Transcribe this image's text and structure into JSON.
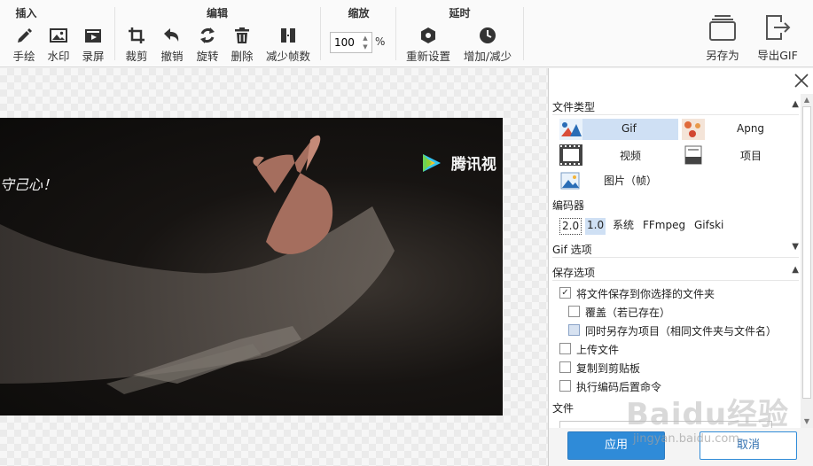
{
  "ribbon": {
    "groups": {
      "insert": "插入",
      "edit": "编辑",
      "zoom": "缩放",
      "delay": "延时"
    },
    "tools": {
      "freehand": "手绘",
      "watermark": "水印",
      "record": "录屏",
      "crop": "裁剪",
      "undo": "撤销",
      "rotate": "旋转",
      "delete": "删除",
      "reduce_frames": "减少帧数",
      "reset_delay": "重新设置",
      "inc_dec_delay": "增加/减少",
      "save_as": "另存为",
      "export_gif": "导出GIF"
    },
    "zoom_value": "100",
    "zoom_unit": "%"
  },
  "canvas": {
    "subtitle": "守己心！",
    "watermark_text": "腾讯视"
  },
  "panel": {
    "file_type_header": "文件类型",
    "file_types": {
      "gif": "Gif",
      "apng": "Apng",
      "video": "视频",
      "project": "项目",
      "image": "图片（帧）"
    },
    "encoder_header": "编码器",
    "encoders": [
      "2.0",
      "1.0",
      "系统",
      "FFmpeg",
      "Gifski"
    ],
    "gif_options_header": "Gif 选项",
    "save_options_header": "保存选项",
    "save_options": {
      "save_to_folder": "将文件保存到你选择的文件夹",
      "overwrite": "覆盖（若已存在）",
      "save_as_project": "同时另存为项目（相同文件夹与文件名）",
      "upload": "上传文件",
      "copy_clipboard": "复制到剪贴板",
      "run_command": "执行编码后置命令"
    },
    "file_header": "文件",
    "apply_button": "应用",
    "cancel_button": "取消"
  },
  "overlay": {
    "baidu_logo": "Baidu经验",
    "baidu_url": "jingyan.baidu.com"
  },
  "colors": {
    "accent": "#2f8bd8",
    "selection": "#cfe0f4"
  }
}
